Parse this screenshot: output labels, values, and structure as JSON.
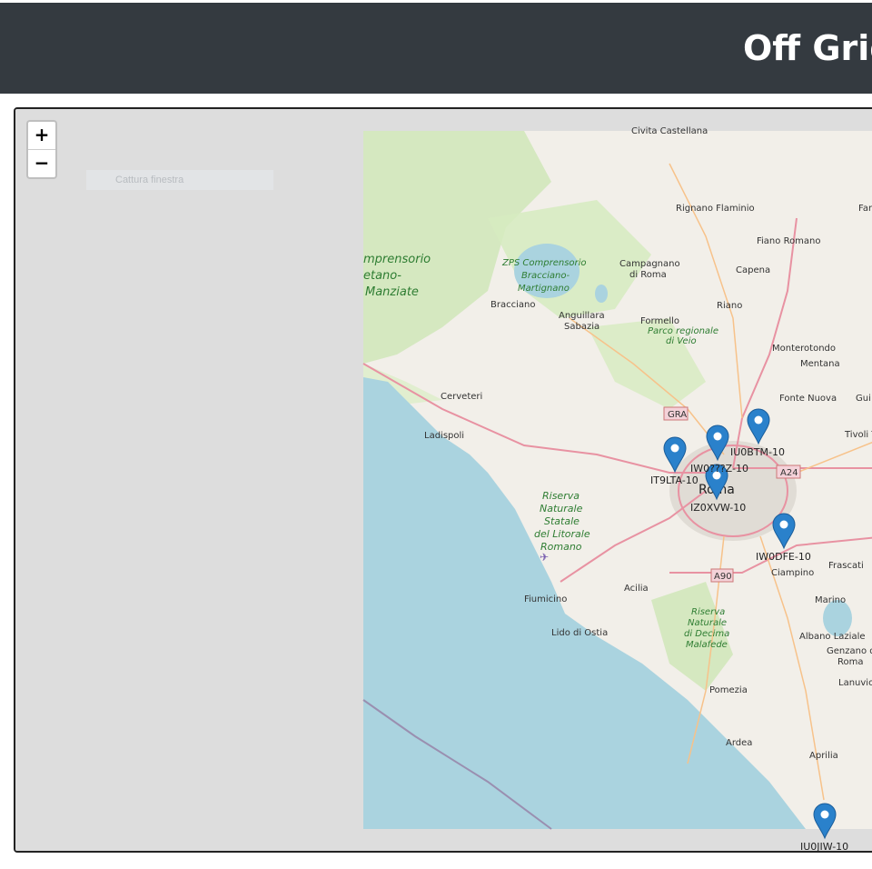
{
  "header": {
    "title": "Off Grid"
  },
  "map": {
    "zoom_in": "+",
    "zoom_out": "−",
    "ghost_label": "Cattura finestra",
    "colors": {
      "sea": "#aad3df",
      "land": "#f2efe9",
      "park": "#cde6b5",
      "motorway": "#e892a2",
      "primary": "#f7c28a"
    },
    "places": {
      "civita": "Civita Castellana",
      "rignano": "Rignano Flaminio",
      "fara": "Fara in",
      "fiano": "Fiano Romano",
      "capena": "Capena",
      "campagnano": "Campagnano",
      "diroma": "di Roma",
      "zps1": "ZPS Comprensorio",
      "zps2": "Bracciano-",
      "zps3": "Martignano",
      "compr1": "mprensorio",
      "compr2": "etano-",
      "compr3": "Manziate",
      "bracciano": "Bracciano",
      "anguillara1": "Anguillara",
      "anguillara2": "Sabazia",
      "riano": "Riano",
      "formello": "Formello",
      "veio1": "Parco regionale",
      "veio2": "di Veio",
      "monterotondo": "Monterotondo",
      "mentana": "Mentana",
      "cerveteri": "Cerveteri",
      "ladispoli": "Ladispoli",
      "fontenuova": "Fonte Nuova",
      "gui": "Gui",
      "tivoli": "Tivoli T",
      "gra": "GRA",
      "a24": "A24",
      "roma": "Roma",
      "riserva1": "Riserva",
      "riserva2": "Naturale",
      "riserva3": "Statale",
      "riserva4": "del Litorale",
      "riserva5": "Romano",
      "a90": "A90",
      "fiumicino": "Fiumicino",
      "acilia": "Acilia",
      "ciampino": "Ciampino",
      "frascati": "Frascati",
      "decima1": "Riserva",
      "decima2": "Naturale",
      "decima3": "di Decima",
      "decima4": "Malafede",
      "lido": "Lido di Ostia",
      "marino": "Marino",
      "albano": "Albano Laziale",
      "genzano1": "Genzano di",
      "genzano2": "Roma",
      "lanuvio": "Lanuvio",
      "pomezia": "Pomezia",
      "ardea": "Ardea",
      "aprilia": "Aprilia"
    },
    "stations": [
      {
        "call": "IU0BTM-10"
      },
      {
        "call": "IW0???Z-10"
      },
      {
        "call": "IT9LTA-10"
      },
      {
        "call": "IZ0XVW-10"
      },
      {
        "call": "IW0DFE-10"
      },
      {
        "call": "IU0JIW-10"
      }
    ]
  }
}
